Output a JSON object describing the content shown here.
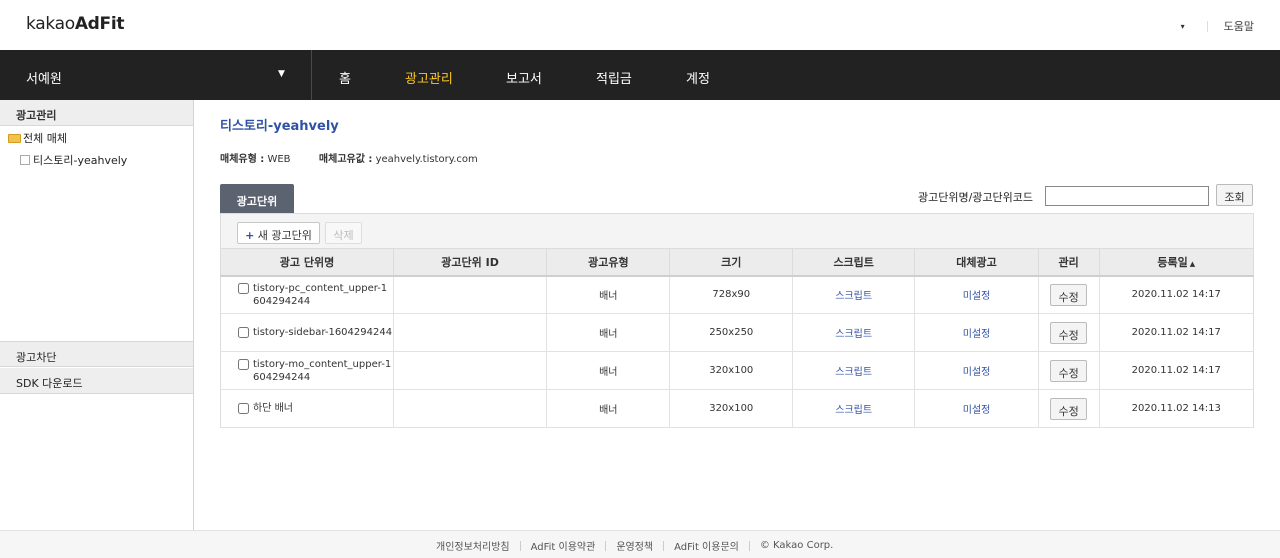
{
  "header": {
    "logo_prefix": "kakao",
    "logo_brand": "AdFit",
    "account_caret": "▾",
    "help_label": "도움말"
  },
  "navbar": {
    "site_name": "서예원",
    "site_caret": "▼",
    "items": [
      {
        "label": "홈"
      },
      {
        "label": "광고관리",
        "active": true
      },
      {
        "label": "보고서"
      },
      {
        "label": "적립금"
      },
      {
        "label": "계정"
      }
    ]
  },
  "sidebar": {
    "section_ad_manage": "광고관리",
    "tree_root": "전체 매체",
    "tree_child": "티스토리-yeahvely",
    "section_block": "광고차단",
    "section_sdk": "SDK 다운로드"
  },
  "main": {
    "title": "티스토리-yeahvely",
    "media_type_label": "매체유형 :",
    "media_type_value": "WEB",
    "media_id_label": "매체고유값 :",
    "media_id_value": "yeahvely.tistory.com",
    "tab_label": "광고단위",
    "search_label": "광고단위명/광고단위코드",
    "search_value": "",
    "search_button": "조회",
    "new_unit_plus": "+",
    "new_unit_button": "새 광고단위",
    "delete_button": "삭제",
    "columns": [
      "광고 단위명",
      "광고단위 ID",
      "광고유형",
      "크기",
      "스크립트",
      "대체광고",
      "관리",
      "등록일"
    ],
    "sort_indicator": "▲",
    "rows": [
      {
        "name": "tistory-pc_content_upper-1604294244",
        "id": "",
        "type": "배너",
        "size": "728x90",
        "script": "스크립트",
        "fallback": "미설정",
        "edit": "수정",
        "date": "2020.11.02 14:17"
      },
      {
        "name": "tistory-sidebar-1604294244",
        "id": "",
        "type": "배너",
        "size": "250x250",
        "script": "스크립트",
        "fallback": "미설정",
        "edit": "수정",
        "date": "2020.11.02 14:17"
      },
      {
        "name": "tistory-mo_content_upper-1604294244",
        "id": "",
        "type": "배너",
        "size": "320x100",
        "script": "스크립트",
        "fallback": "미설정",
        "edit": "수정",
        "date": "2020.11.02 14:17"
      },
      {
        "name": "하단 배너",
        "id": "",
        "type": "배너",
        "size": "320x100",
        "script": "스크립트",
        "fallback": "미설정",
        "edit": "수정",
        "date": "2020.11.02 14:13"
      }
    ]
  },
  "footer": {
    "links": [
      "개인정보처리방침",
      "AdFit 이용약관",
      "운영정책",
      "AdFit 이용문의",
      "© Kakao Corp."
    ]
  },
  "colors": {
    "nav_bg": "#222222",
    "nav_active": "#f9c623",
    "link_blue": "#2f52a6",
    "tab_bg": "#5b6270"
  }
}
